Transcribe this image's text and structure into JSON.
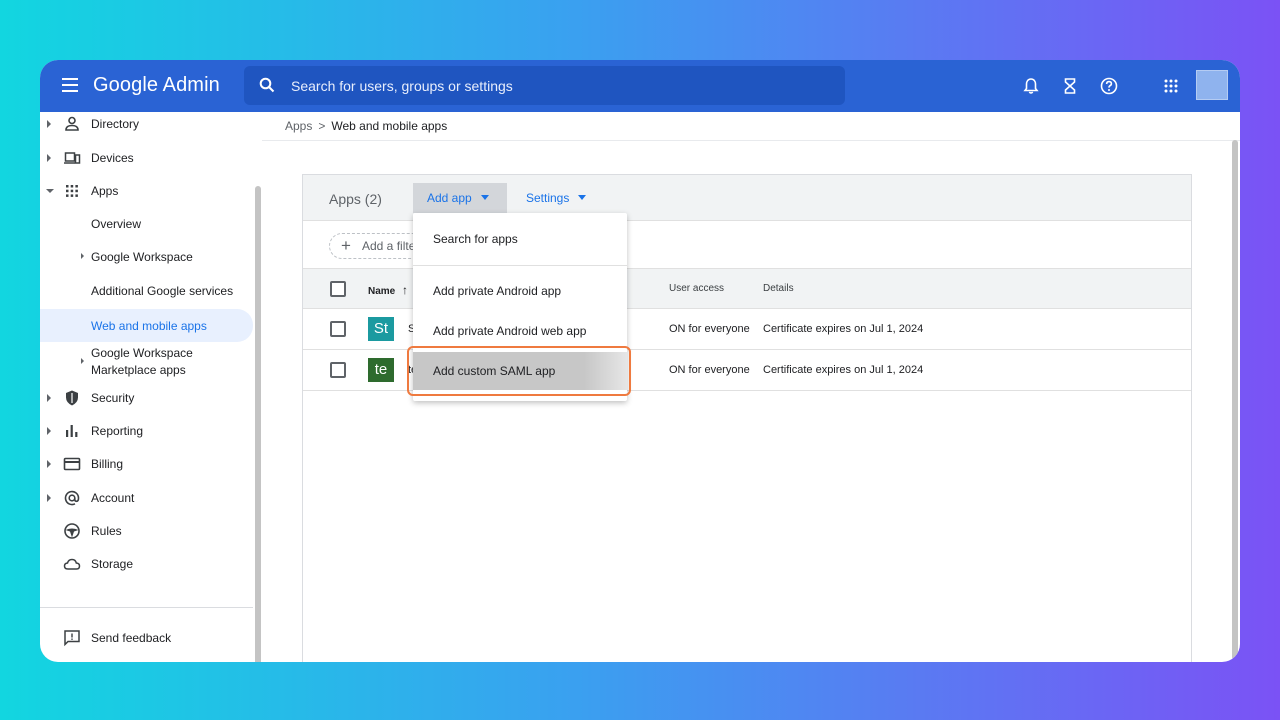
{
  "header": {
    "brand": "Google Admin",
    "search_placeholder": "Search for users, groups or settings",
    "icons": [
      "notifications-icon",
      "hourglass-icon",
      "help-icon",
      "apps-grid-icon"
    ]
  },
  "sidebar": {
    "items": [
      {
        "label": "Directory",
        "icon": "person-icon"
      },
      {
        "label": "Devices",
        "icon": "devices-icon"
      },
      {
        "label": "Apps",
        "icon": "apps-grid-icon"
      },
      {
        "label": "Overview"
      },
      {
        "label": "Google Workspace"
      },
      {
        "label": "Additional Google services"
      },
      {
        "label": "Web and mobile apps"
      },
      {
        "label": "Google Workspace"
      },
      {
        "label": "Marketplace apps"
      },
      {
        "label": "Security",
        "icon": "shield-icon"
      },
      {
        "label": "Reporting",
        "icon": "bar-chart-icon"
      },
      {
        "label": "Billing",
        "icon": "credit-card-icon"
      },
      {
        "label": "Account",
        "icon": "at-sign-icon"
      },
      {
        "label": "Rules",
        "icon": "steering-icon"
      },
      {
        "label": "Storage",
        "icon": "cloud-icon"
      }
    ],
    "feedback_label": "Send feedback"
  },
  "breadcrumb": {
    "parent": "Apps",
    "sep": ">",
    "current": "Web and mobile apps"
  },
  "panel": {
    "title": "Apps (2)",
    "add_app_label": "Add app",
    "settings_label": "Settings",
    "filter_label": "Add a filte"
  },
  "table": {
    "headers": {
      "name": "Name",
      "sort_arrow": "↑",
      "access": "User access",
      "details": "Details"
    },
    "rows": [
      {
        "tile": "St",
        "tile_color": "#1b9aa0",
        "name": "S",
        "access": "ON for everyone",
        "details": "Certificate expires on Jul 1, 2024"
      },
      {
        "tile": "te",
        "tile_color": "#2e6b2e",
        "name": "te",
        "access": "ON for everyone",
        "details": "Certificate expires on Jul 1, 2024"
      }
    ]
  },
  "menu": {
    "items": [
      "Search for apps",
      "Add private Android app",
      "Add private Android web app",
      "Add custom SAML app"
    ]
  },
  "colors": {
    "header_blue": "#2a63d4",
    "accent": "#1a73e8",
    "highlight_ring": "#ef7a3f"
  }
}
